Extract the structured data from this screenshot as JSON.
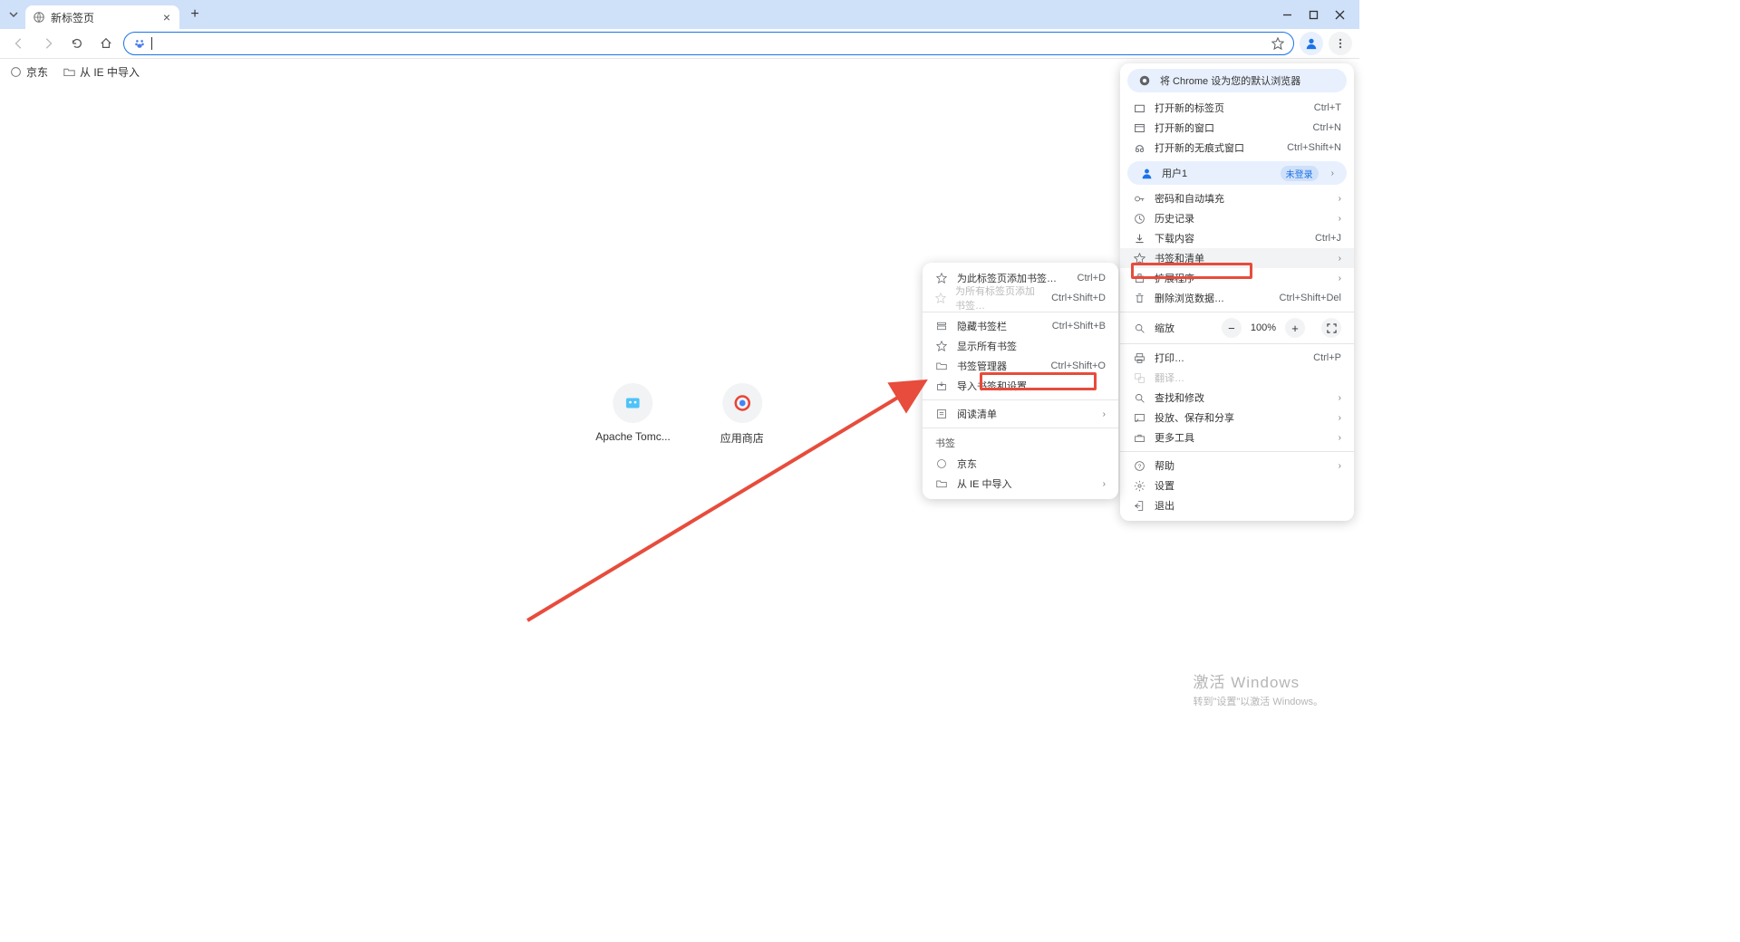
{
  "tab": {
    "title": "新标签页"
  },
  "bookmarksBar": {
    "items": [
      {
        "label": "京东"
      },
      {
        "label": "从 IE 中导入"
      }
    ]
  },
  "shortcuts": [
    {
      "label": "Apache Tomc..."
    },
    {
      "label": "应用商店"
    }
  ],
  "mainMenu": {
    "banner": "将 Chrome 设为您的默认浏览器",
    "newTab": {
      "label": "打开新的标签页",
      "shortcut": "Ctrl+T"
    },
    "newWindow": {
      "label": "打开新的窗口",
      "shortcut": "Ctrl+N"
    },
    "newIncognito": {
      "label": "打开新的无痕式窗口",
      "shortcut": "Ctrl+Shift+N"
    },
    "profile": {
      "label": "用户1",
      "status": "未登录"
    },
    "passwords": {
      "label": "密码和自动填充"
    },
    "history": {
      "label": "历史记录"
    },
    "downloads": {
      "label": "下载内容",
      "shortcut": "Ctrl+J"
    },
    "bookmarksLists": {
      "label": "书签和清单"
    },
    "extensions": {
      "label": "扩展程序"
    },
    "clearData": {
      "label": "删除浏览数据…",
      "shortcut": "Ctrl+Shift+Del"
    },
    "zoom": {
      "label": "缩放",
      "value": "100%"
    },
    "print": {
      "label": "打印…",
      "shortcut": "Ctrl+P"
    },
    "translate": {
      "label": "翻译…"
    },
    "find": {
      "label": "查找和修改"
    },
    "cast": {
      "label": "投放、保存和分享"
    },
    "moreTools": {
      "label": "更多工具"
    },
    "help": {
      "label": "帮助"
    },
    "settings": {
      "label": "设置"
    },
    "exit": {
      "label": "退出"
    }
  },
  "submenu": {
    "addBookmarkCurrent": {
      "label": "为此标签页添加书签…",
      "shortcut": "Ctrl+D"
    },
    "addBookmarkAll": {
      "label": "为所有标签页添加书签…",
      "shortcut": "Ctrl+Shift+D"
    },
    "hideBar": {
      "label": "隐藏书签栏",
      "shortcut": "Ctrl+Shift+B"
    },
    "showAll": {
      "label": "显示所有书签"
    },
    "manager": {
      "label": "书签管理器",
      "shortcut": "Ctrl+Shift+O"
    },
    "import": {
      "label": "导入书签和设置…"
    },
    "readingList": {
      "label": "阅读清单"
    },
    "sectionHeader": "书签",
    "jd": {
      "label": "京东"
    },
    "ieImport": {
      "label": "从 IE 中导入"
    }
  },
  "watermark": {
    "line1": "激活 Windows",
    "line2": "转到\"设置\"以激活 Windows。"
  }
}
